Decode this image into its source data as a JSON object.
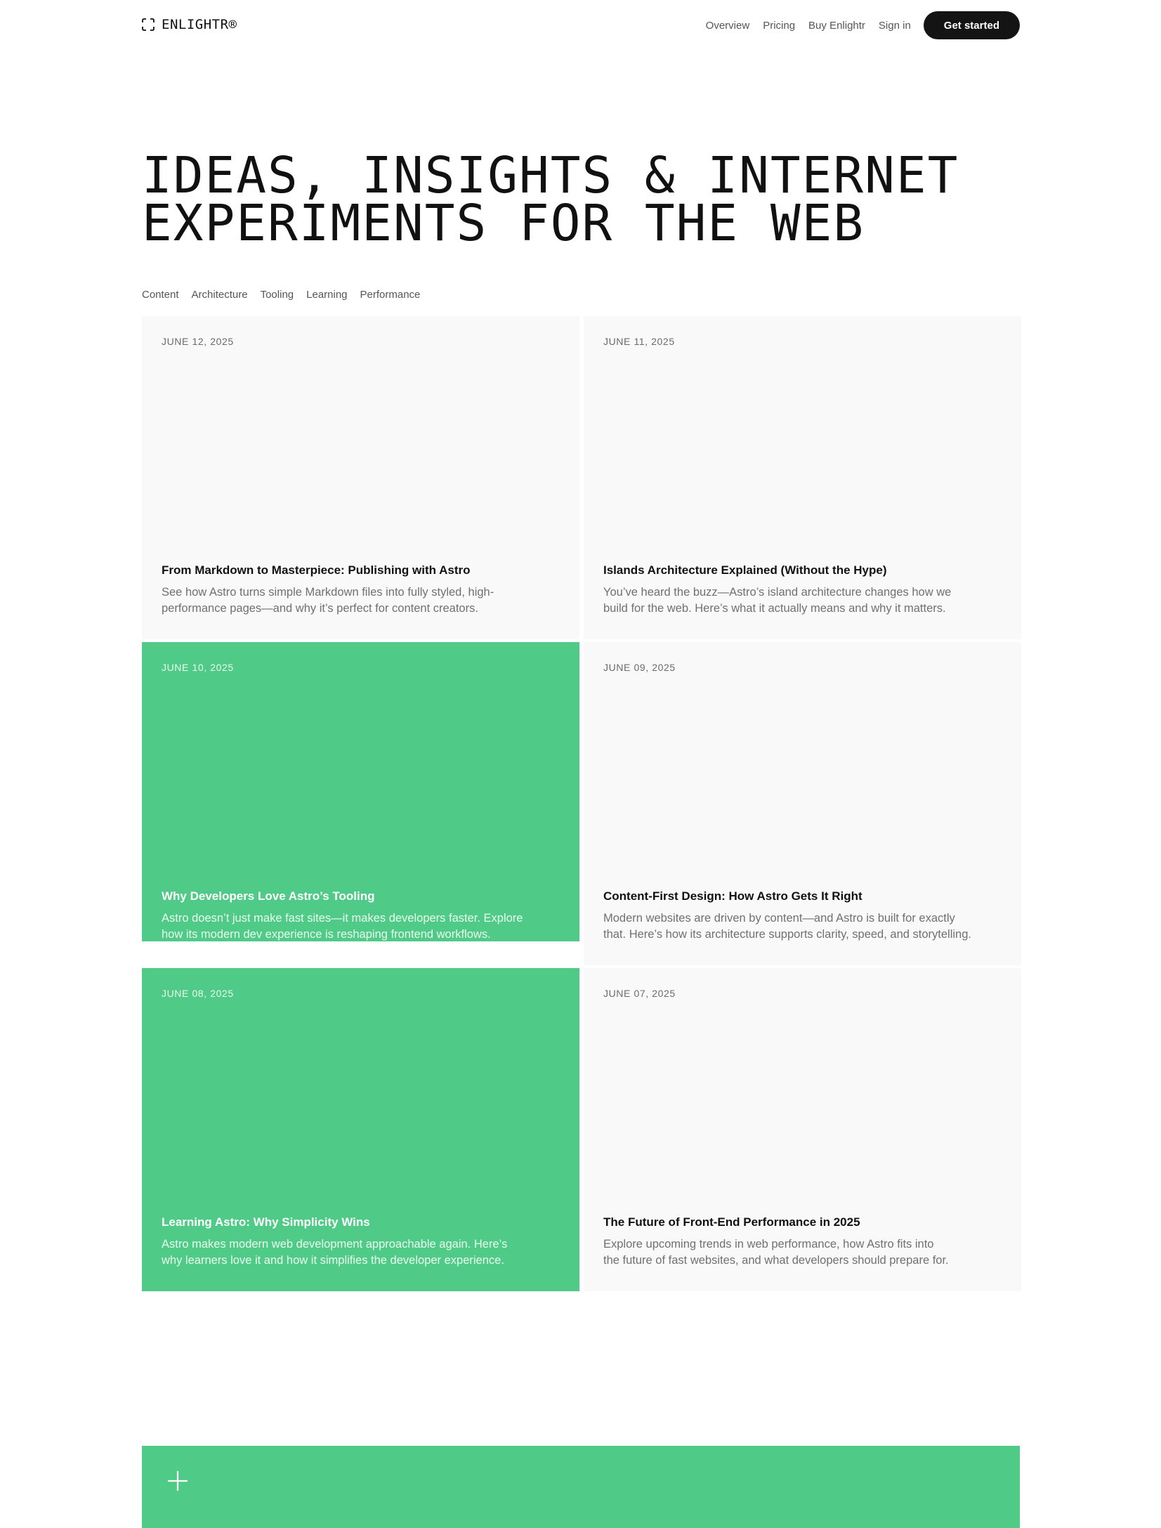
{
  "header": {
    "logo_text": "ENLIGHTR®",
    "nav": [
      "Overview",
      "Pricing",
      "Buy Enlightr",
      "Sign in"
    ],
    "cta_label": "Get started"
  },
  "hero": {
    "title_line1": "IDEAS, INSIGHTS & INTERNET",
    "title_line2": "EXPERIMENTS FOR THE WEB"
  },
  "filters": [
    "Content",
    "Architecture",
    "Tooling",
    "Learning",
    "Performance"
  ],
  "posts": [
    {
      "date": "JUNE 12, 2025",
      "title": "From Markdown to Masterpiece: Publishing with Astro",
      "desc_line1": "See how Astro turns simple Markdown files into fully styled, high-",
      "desc_line2": "performance pages—and why it’s perfect for content creators.",
      "variant": "light"
    },
    {
      "date": "JUNE 11, 2025",
      "title": "Islands Architecture Explained (Without the Hype)",
      "desc_line1": "You’ve heard the buzz—Astro’s island architecture changes how we",
      "desc_line2": "build for the web. Here’s what it actually means and why it matters.",
      "variant": "light"
    },
    {
      "date": "JUNE 10, 2025",
      "title": "Why Developers Love Astro’s Tooling",
      "desc_line1": "Astro doesn’t just make fast sites—it makes developers faster. Explore",
      "desc_line2": "how its modern dev experience is reshaping frontend workflows.",
      "variant": "green"
    },
    {
      "date": "JUNE 09, 2025",
      "title": "Content-First Design: How Astro Gets It Right",
      "desc_line1": "Modern websites are driven by content—and Astro is built for exactly",
      "desc_line2": "that. Here’s how its architecture supports clarity, speed, and storytelling.",
      "variant": "light"
    },
    {
      "date": "JUNE 08, 2025",
      "title": "Learning Astro: Why Simplicity Wins",
      "desc_line1": "Astro makes modern web development approachable again. Here’s",
      "desc_line2": "why learners love it and how it simplifies the developer experience.",
      "variant": "green"
    },
    {
      "date": "JUNE 07, 2025",
      "title": "The Future of Front-End Performance in 2025",
      "desc_line1": "Explore upcoming trends in web performance, how Astro fits into",
      "desc_line2": "the future of fast websites, and what developers should prepare for.",
      "variant": "light"
    }
  ],
  "icons": {
    "logo": "bracket-square-icon",
    "footer": "plus-icon"
  },
  "colors": {
    "accent_green": "#4fca87",
    "cta_black": "#141414",
    "card_light": "#f9f9f9"
  }
}
